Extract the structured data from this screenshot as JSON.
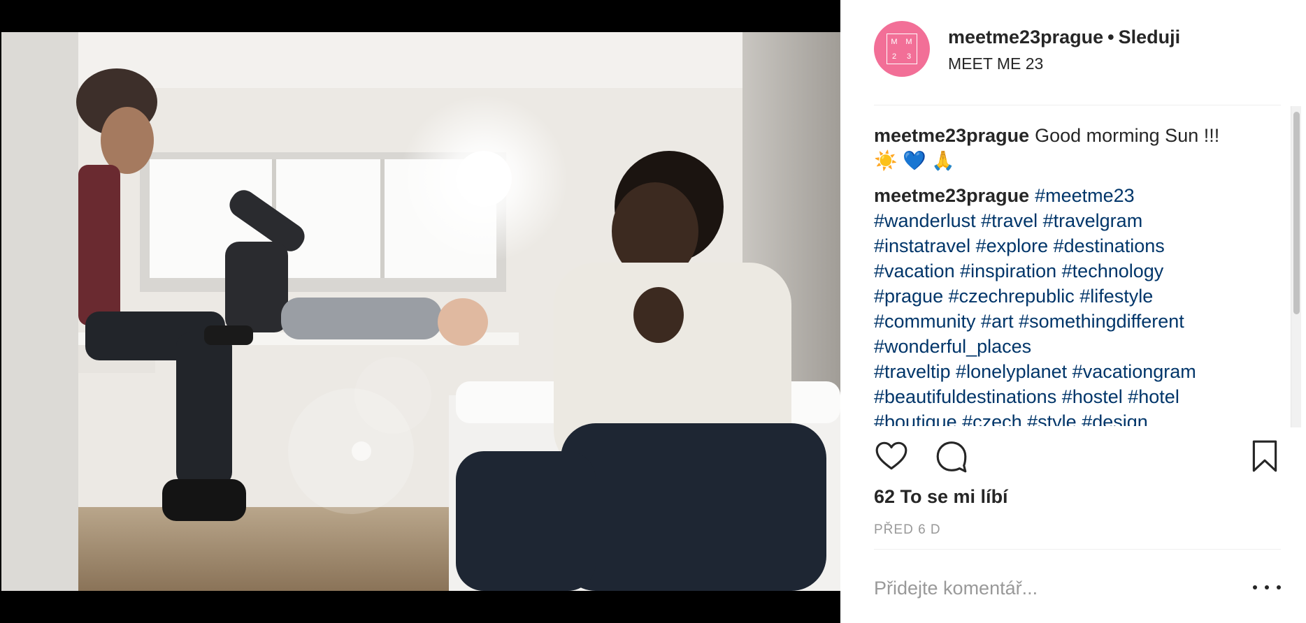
{
  "post": {
    "photo": {
      "description_icon": "photo-image"
    },
    "author": {
      "username": "meetme23prague",
      "separator": "•",
      "follow_status": "Sleduji",
      "location": "MEET ME 23",
      "avatar_logo": [
        "M",
        "M",
        "2",
        "3"
      ]
    },
    "caption": {
      "username": "meetme23prague",
      "text": "Good morming Sun !!!",
      "emojis": "☀️ 💙 🙏"
    },
    "hashtag_comment": {
      "username": "meetme23prague",
      "lines": [
        "#meetme23",
        "#wanderlust #travel #travelgram",
        "#instatravel #explore #destinations",
        "#vacation #inspiration #technology",
        "#prague #czechrepublic #lifestyle",
        "#community #art #somethingdifferent",
        "#wonderful_places",
        "#traveltip #lonelyplanet #vacationgram",
        "#beautifuldestinations #hostel #hotel",
        "#boutique #czech #style #design"
      ]
    },
    "actions": {
      "like_icon": "heart-outline-icon",
      "comment_icon": "comment-bubble-icon",
      "save_icon": "bookmark-icon"
    },
    "likes_text": "62 To se mi líbí",
    "time_ago": "PŘED 6 D",
    "comment_placeholder": "Přidejte komentář...",
    "more_icon": "more-options-icon"
  },
  "colors": {
    "avatar_bg": "#f26f97",
    "hashtag": "#003569",
    "muted": "#999999",
    "text": "#262626"
  }
}
